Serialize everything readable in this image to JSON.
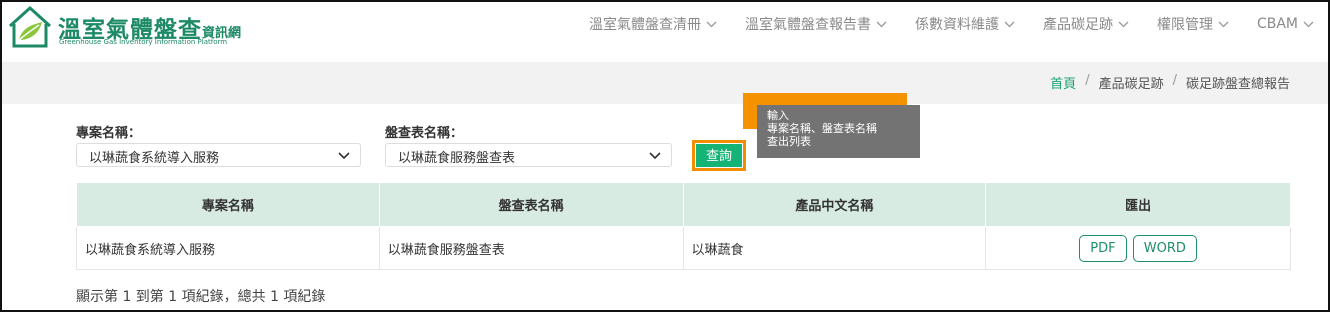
{
  "brand": {
    "title": "溫室氣體盤查",
    "title_sub": "資訊網",
    "subtitle_en": "Greenhouse Gas Inventory Information Platform",
    "color": "#1d8a66"
  },
  "nav": {
    "items": [
      {
        "label": "溫室氣體盤查清冊"
      },
      {
        "label": "溫室氣體盤查報告書"
      },
      {
        "label": "係數資料維護"
      },
      {
        "label": "產品碳足跡"
      },
      {
        "label": "權限管理"
      },
      {
        "label": "CBAM"
      }
    ]
  },
  "breadcrumb": {
    "home": "首頁",
    "items": [
      "產品碳足跡",
      "碳足跡盤查總報告"
    ],
    "separator": "/"
  },
  "filters": {
    "project_label": "專案名稱：",
    "project_value": "以琳蔬食系統導入服務",
    "sheet_label": "盤查表名稱：",
    "sheet_value": "以琳蔬食服務盤查表",
    "query_button": "查詢"
  },
  "annotation": {
    "text": "輸入\n專案名稱、盤查表名稱\n查出列表",
    "highlight_color": "#f28c00"
  },
  "table": {
    "headers": [
      "專案名稱",
      "盤查表名稱",
      "產品中文名稱",
      "匯出"
    ],
    "rows": [
      {
        "project": "以琳蔬食系統導入服務",
        "sheet": "以琳蔬食服務盤查表",
        "product": "以琳蔬食",
        "pdf": "PDF",
        "word": "WORD"
      }
    ]
  },
  "summary": "顯示第 1 到第 1 項紀錄，總共 1 項紀錄",
  "colors": {
    "accent": "#16b376",
    "header_bg": "#d8ebe3",
    "crumb_bg": "#f2f2f2"
  }
}
